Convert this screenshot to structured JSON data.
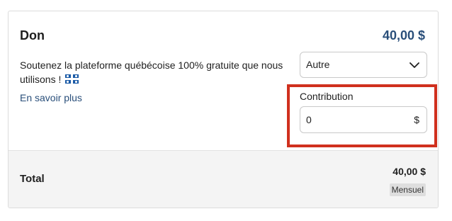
{
  "donation": {
    "title": "Don",
    "amount": "40,00 $",
    "description": "Soutenez la plateforme québécoise 100% gratuite que nous utilisons !",
    "flag_icon": "quebec-flag-icon",
    "learn_more": "En savoir plus",
    "select": {
      "value": "Autre",
      "icon": "chevron-down-icon"
    },
    "contribution": {
      "label": "Contribution",
      "value": "0",
      "currency": "$"
    }
  },
  "summary": {
    "total_label": "Total",
    "total_amount": "40,00 $",
    "frequency_badge": "Mensuel"
  },
  "colors": {
    "accent": "#2a4f7a",
    "highlight": "#d0301e",
    "footer_bg": "#f4f4f4"
  }
}
